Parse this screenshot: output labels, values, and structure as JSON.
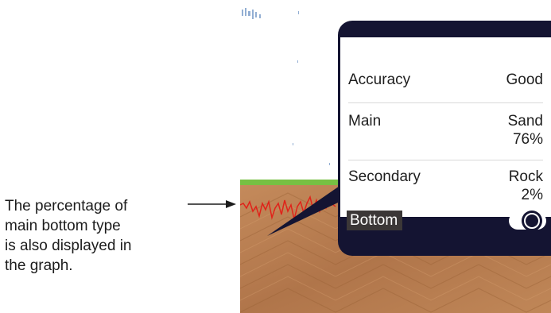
{
  "annotation": {
    "lines": [
      "The percentage of",
      "main bottom type",
      "is also displayed in",
      "the graph."
    ]
  },
  "popup": {
    "rows": [
      {
        "label": "Accuracy",
        "value_line1": "Good",
        "value_line2": ""
      },
      {
        "label": "Main",
        "value_line1": "Sand",
        "value_line2": "76%"
      },
      {
        "label": "Secondary",
        "value_line1": "Rock",
        "value_line2": "2%"
      }
    ],
    "bottom_toggle": {
      "label": "Bottom",
      "state": "on"
    }
  },
  "colors": {
    "panel": "#141432",
    "seabed_line": "#77c043",
    "graph_line": "#e0231a",
    "terrain": "#b57a4c"
  },
  "icons": {
    "arrow": "right-arrow-icon",
    "toggle": "toggle-switch-icon"
  }
}
